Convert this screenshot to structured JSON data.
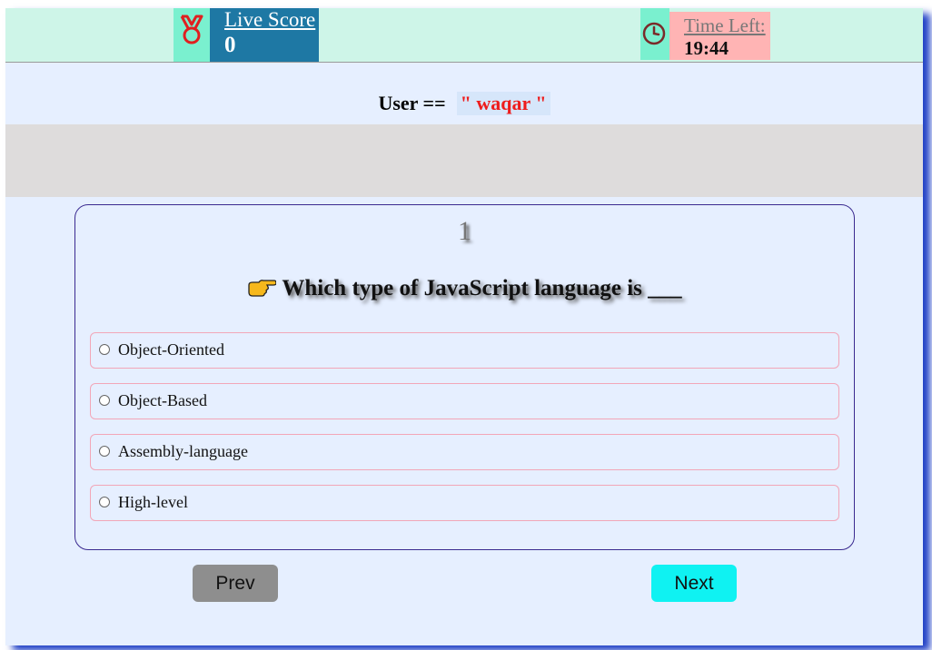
{
  "header": {
    "score_icon": "medal-icon",
    "score_label": "Live Score",
    "score_value": "0",
    "time_icon": "clock-icon",
    "time_label": "Time Left:",
    "time_value": "19:44"
  },
  "user": {
    "prefix": "User ==",
    "name": "\" waqar \""
  },
  "question": {
    "number": "1",
    "pointer_icon": "pointing-hand-icon",
    "text": "Which type of JavaScript language is ___",
    "options": [
      {
        "label": "Object-Oriented",
        "selected": false
      },
      {
        "label": "Object-Based",
        "selected": false
      },
      {
        "label": "Assembly-language",
        "selected": false
      },
      {
        "label": "High-level",
        "selected": false
      }
    ]
  },
  "nav": {
    "prev_label": "Prev",
    "next_label": "Next"
  },
  "colors": {
    "topbar": "#cef5e8",
    "score_box": "#1e78a4",
    "time_box": "#ffb4b4",
    "next_button": "#0ff2f2",
    "prev_button": "#8e8e8e"
  }
}
